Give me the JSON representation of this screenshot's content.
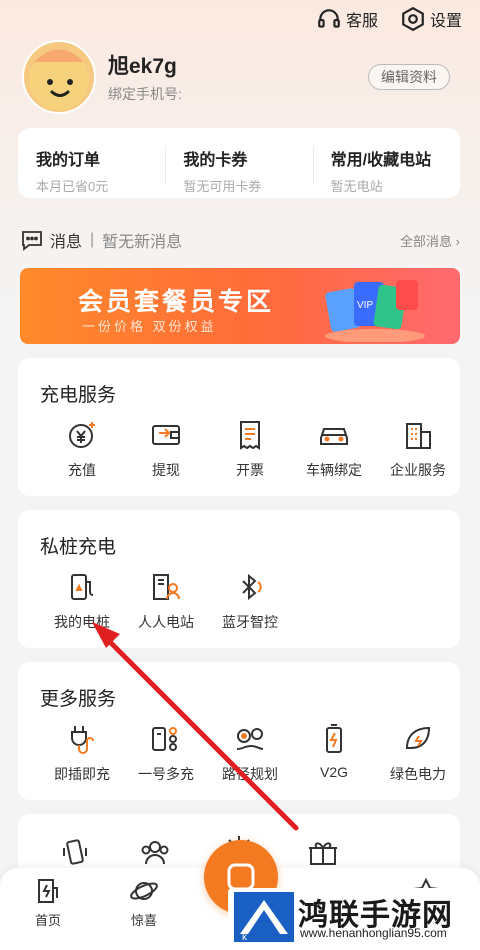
{
  "header": {
    "service_label": "客服",
    "settings_label": "设置"
  },
  "profile": {
    "username": "旭ek7g",
    "phone_label": "绑定手机号:",
    "edit_label": "编辑资料"
  },
  "quick": [
    {
      "title": "我的订单",
      "sub": "本月已省0元"
    },
    {
      "title": "我的卡券",
      "sub": "暂无可用卡券"
    },
    {
      "title": "常用/收藏电站",
      "sub": "暂无电站"
    }
  ],
  "messages": {
    "label": "消息",
    "status": "暂无新消息",
    "all": "全部消息 ›"
  },
  "banner": {
    "title": "会员套餐员专区",
    "subtitle": "一份价格  双份权益"
  },
  "charging_service": {
    "title": "充电服务",
    "items": [
      "充值",
      "提现",
      "开票",
      "车辆绑定",
      "企业服务"
    ]
  },
  "private_pile": {
    "title": "私桩充电",
    "items": [
      "我的电桩",
      "人人电站",
      "蓝牙智控"
    ]
  },
  "more_services": {
    "title": "更多服务",
    "items": [
      "即插即充",
      "一号多充",
      "路径规划",
      "V2G",
      "绿色电力"
    ]
  },
  "tabbar": {
    "home": "首页",
    "surprise": "惊喜"
  },
  "watermark": {
    "title": "鸿联手游网",
    "url": "www.henanhonglian95.com"
  },
  "colors": {
    "accent": "#f47a22",
    "arrow": "#e02020"
  }
}
